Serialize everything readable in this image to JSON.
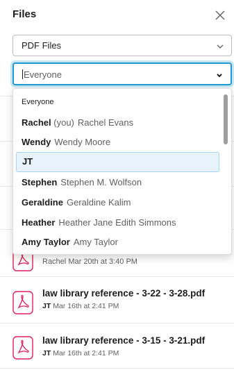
{
  "header": {
    "title": "Files"
  },
  "filters": {
    "type_value": "PDF Files",
    "people_value": "Everyone"
  },
  "dropdown": {
    "options": [
      {
        "name": "Everyone",
        "you": "",
        "full": ""
      },
      {
        "name": "Rachel",
        "you": "(you)",
        "full": "Rachel Evans"
      },
      {
        "name": "Wendy",
        "you": "",
        "full": "Wendy Moore"
      },
      {
        "name": "JT",
        "you": "",
        "full": ""
      },
      {
        "name": "Stephen",
        "you": "",
        "full": "Stephen M. Wolfson"
      },
      {
        "name": "Geraldine",
        "you": "",
        "full": "Geraldine Kalim"
      },
      {
        "name": "Heather",
        "you": "",
        "full": "Heather Jane Edith Simmons"
      },
      {
        "name": "Amy Taylor",
        "you": "",
        "full": "Amy Taylor"
      }
    ],
    "selected": "JT"
  },
  "files": [
    {
      "name": "",
      "author": "Rachel",
      "date": "Mar 20th at 3:40 PM"
    },
    {
      "name": "law library reference - 3-22 - 3-28.pdf",
      "author": "JT",
      "date": "Mar 16th at 2:41 PM"
    },
    {
      "name": "law library reference - 3-15 - 3-21.pdf",
      "author": "JT",
      "date": "Mar 16th at 2:41 PM"
    }
  ],
  "colors": {
    "accent": "#1d9bd1",
    "pdf_red": "#e01e5a",
    "selected_bg": "#e6f3fb"
  },
  "icons": {
    "close": "close-icon",
    "chevron": "chevron-down-icon",
    "file": "pdf-file-icon"
  }
}
